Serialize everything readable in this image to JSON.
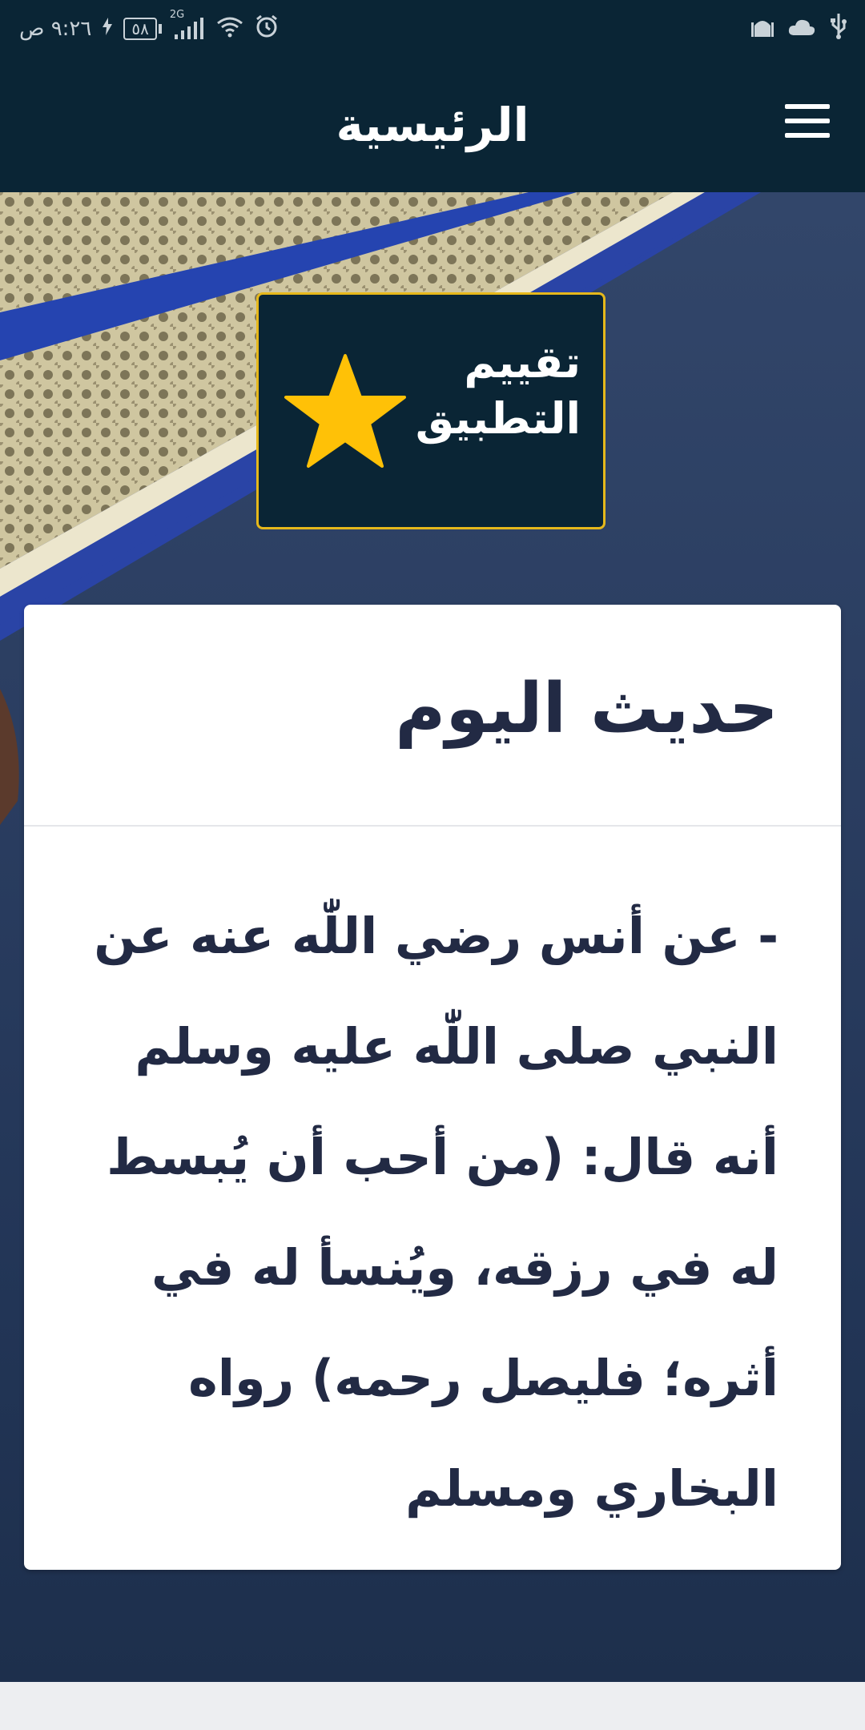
{
  "status_bar": {
    "time": "٩:٢٦ ص",
    "battery": "٥٨",
    "network": "2G"
  },
  "header": {
    "title": "الرئيسية",
    "menu_icon": "hamburger-menu-icon"
  },
  "rate_app": {
    "label": "تقييم التطبيق",
    "icon": "star-icon",
    "star_color": "#ffc107",
    "border_color": "#e6b81b"
  },
  "hadith_card": {
    "title": "حديث اليوم",
    "text": "- عن أنس رضي اللّٰه عنه عن النبي صلى اللّٰه عليه وسلم أنه قال: (من أحب أن يُبسط له في رزقه، ويُنسأ له في أثره؛ فليصل رحمه) رواه البخاري ومسلم"
  },
  "colors": {
    "primary": "#0a2535",
    "text_dark": "#222a44",
    "card_bg": "#ffffff"
  }
}
